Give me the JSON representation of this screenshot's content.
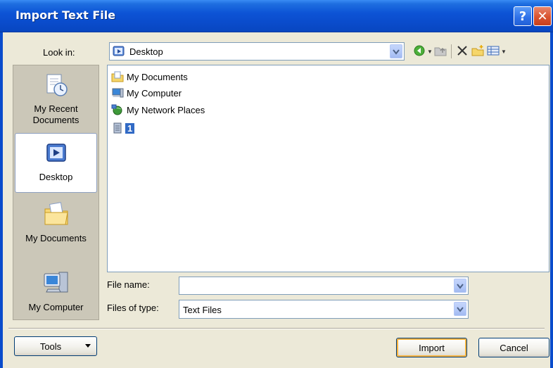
{
  "window": {
    "title": "Import Text File",
    "help_glyph": "?",
    "close_glyph": "✕"
  },
  "lookin": {
    "label": "Look in:",
    "value": "Desktop"
  },
  "toolbar": {
    "icons": [
      "back-icon",
      "up-folder-icon",
      "delete-icon",
      "new-folder-icon",
      "views-icon"
    ]
  },
  "places": [
    {
      "label": "My Recent Documents",
      "icon": "recent-documents-icon"
    },
    {
      "label": "Desktop",
      "icon": "desktop-icon",
      "selected": true
    },
    {
      "label": "My Documents",
      "icon": "my-documents-icon"
    },
    {
      "label": "My Computer",
      "icon": "my-computer-icon"
    }
  ],
  "files": [
    {
      "label": "My Documents",
      "icon": "folder-documents-icon"
    },
    {
      "label": "My Computer",
      "icon": "computer-icon"
    },
    {
      "label": "My Network Places",
      "icon": "network-places-icon"
    },
    {
      "label": "1",
      "icon": "file-icon",
      "selected": true
    }
  ],
  "file_name": {
    "label": "File name:",
    "value": ""
  },
  "file_type": {
    "label": "Files of type:",
    "value": "Text Files"
  },
  "buttons": {
    "tools": "Tools",
    "import": "Import",
    "cancel": "Cancel"
  },
  "colors": {
    "titlebar": "#0a4ccc",
    "dialog_bg": "#ece9d8",
    "selection": "#316ac5",
    "close_button": "#d9532f"
  }
}
